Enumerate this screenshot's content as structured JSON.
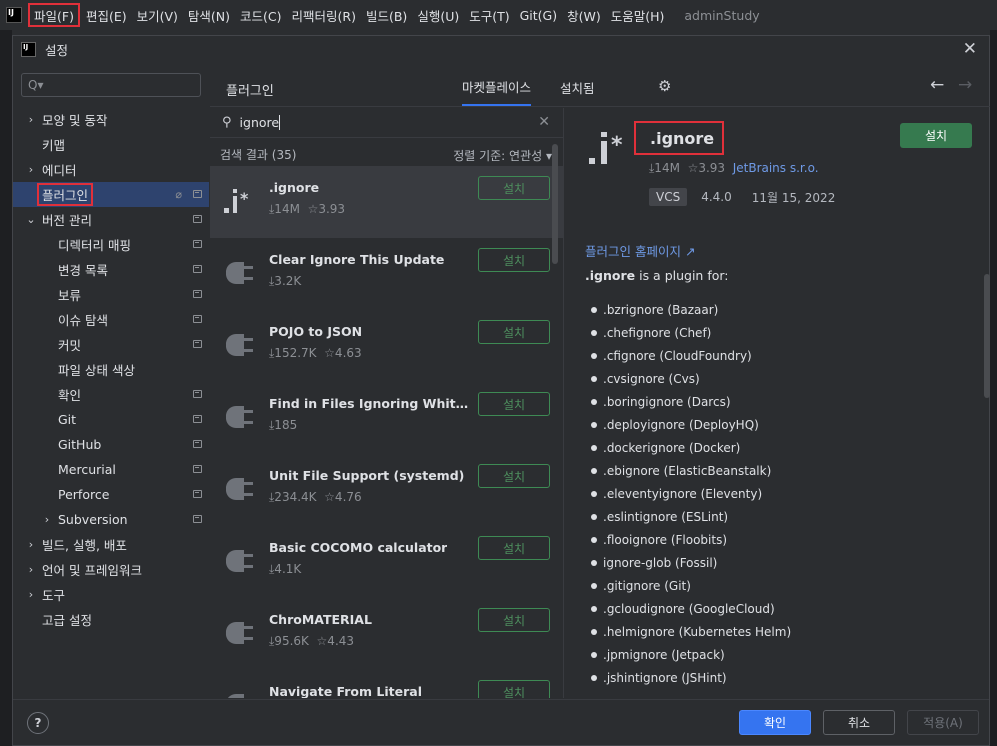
{
  "menubar": {
    "items": [
      "파일(F)",
      "편집(E)",
      "보기(V)",
      "탐색(N)",
      "코드(C)",
      "리팩터링(R)",
      "빌드(B)",
      "실행(U)",
      "도구(T)",
      "Git(G)",
      "창(W)",
      "도움말(H)"
    ],
    "project": "adminStudy"
  },
  "dialog": {
    "title": "설정",
    "close_icon": "close-icon"
  },
  "sidebar": {
    "search_placeholder": "Q▾",
    "items": [
      {
        "label": "모양 및 동작",
        "arrow": "›"
      },
      {
        "label": "키맵",
        "arrow": ""
      },
      {
        "label": "에디터",
        "arrow": "›"
      },
      {
        "label": "플러그인",
        "arrow": ""
      },
      {
        "label": "버전 관리",
        "arrow": "⌄"
      },
      {
        "label": "디렉터리 매핑",
        "arrow": ""
      },
      {
        "label": "변경 목록",
        "arrow": ""
      },
      {
        "label": "보류",
        "arrow": ""
      },
      {
        "label": "이슈 탐색",
        "arrow": ""
      },
      {
        "label": "커밋",
        "arrow": ""
      },
      {
        "label": "파일 상태 색상",
        "arrow": ""
      },
      {
        "label": "확인",
        "arrow": ""
      },
      {
        "label": "Git",
        "arrow": ""
      },
      {
        "label": "GitHub",
        "arrow": ""
      },
      {
        "label": "Mercurial",
        "arrow": ""
      },
      {
        "label": "Perforce",
        "arrow": ""
      },
      {
        "label": "Subversion",
        "arrow": "›"
      },
      {
        "label": "빌드, 실행, 배포",
        "arrow": "›"
      },
      {
        "label": "언어 및 프레임워크",
        "arrow": "›"
      },
      {
        "label": "도구",
        "arrow": "›"
      },
      {
        "label": "고급 설정",
        "arrow": ""
      }
    ]
  },
  "header": {
    "title": "플러그인",
    "tabs": [
      "마켓플레이스",
      "설치됨"
    ],
    "back": "←",
    "forward": "→"
  },
  "search": {
    "value": "ignore",
    "results": "검색 결과 (35)",
    "sort": "정렬 기준: 연관성 ▾"
  },
  "plugins": [
    {
      "name": ".ignore",
      "downloads": "⤓14M",
      "rating": "☆3.93",
      "install": "설치"
    },
    {
      "name": "Clear Ignore This Update",
      "downloads": "⤓3.2K",
      "rating": "",
      "install": "설치"
    },
    {
      "name": "POJO to JSON",
      "downloads": "⤓152.7K",
      "rating": "☆4.63",
      "install": "설치"
    },
    {
      "name": "Find in Files Ignoring Whitespace",
      "downloads": "⤓185",
      "rating": "",
      "install": "설치"
    },
    {
      "name": "Unit File Support (systemd)",
      "downloads": "⤓234.4K",
      "rating": "☆4.76",
      "install": "설치"
    },
    {
      "name": "Basic COCOMO calculator",
      "downloads": "⤓4.1K",
      "rating": "",
      "install": "설치"
    },
    {
      "name": "ChroMATERIAL",
      "downloads": "⤓95.6K",
      "rating": "☆4.43",
      "install": "설치"
    },
    {
      "name": "Navigate From Literal",
      "downloads": "",
      "rating": "",
      "install": "설치"
    }
  ],
  "detail": {
    "name": ".ignore",
    "install": "설치",
    "downloads": "⤓14M",
    "rating": "☆3.93",
    "vendor": "JetBrains s.r.o.",
    "tag": "VCS",
    "version": "4.4.0",
    "date": "11월 15, 2022",
    "homepage": "플러그인 홈페이지 ↗",
    "desc_bold": ".ignore",
    "desc_rest": " is a plugin for:",
    "formats": [
      ".bzrignore (Bazaar)",
      ".chefignore (Chef)",
      ".cfignore (CloudFoundry)",
      ".cvsignore (Cvs)",
      ".boringignore (Darcs)",
      ".deployignore (DeployHQ)",
      ".dockerignore (Docker)",
      ".ebignore (ElasticBeanstalk)",
      ".eleventyignore (Eleventy)",
      ".eslintignore (ESLint)",
      ".flooignore (Floobits)",
      "ignore-glob (Fossil)",
      ".gitignore (Git)",
      ".gcloudignore (GoogleCloud)",
      ".helmignore (Kubernetes Helm)",
      ".jpmignore (Jetpack)",
      ".jshintignore (JSHint)"
    ]
  },
  "footer": {
    "help": "?",
    "ok": "확인",
    "cancel": "취소",
    "apply": "적용(A)"
  },
  "colors": {
    "accent": "#3574f0",
    "install_green": "#367a4f",
    "highlight_red": "#e0303a",
    "selection": "#2e436e"
  }
}
